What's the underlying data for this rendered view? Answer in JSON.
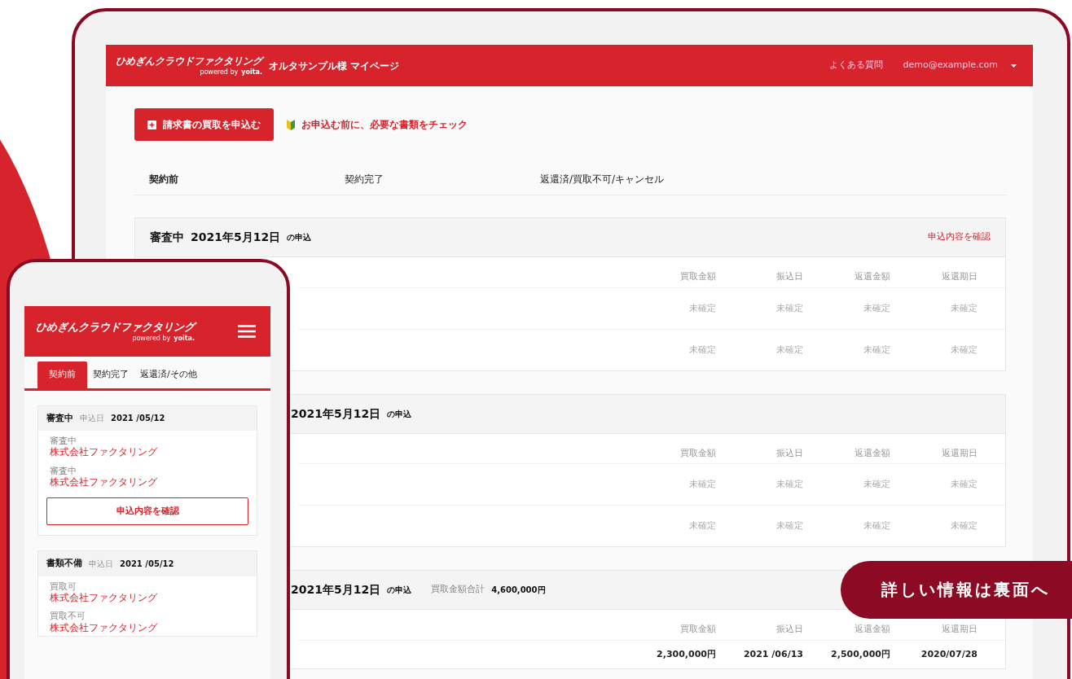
{
  "desktop": {
    "header": {
      "logo": "ひめぎんクラウドファクタリング",
      "powered_by": "powered by",
      "brand": "yoita.",
      "title": "オルタサンプル様 マイページ",
      "faq": "よくある質問",
      "user": "demo@example.com"
    },
    "apply_button": "請求書の買取を申込む",
    "check_link": "お申込む前に、必要な書類をチェック",
    "tabs": [
      {
        "label": "契約前",
        "selected": true
      },
      {
        "label": "契約完了",
        "selected": false
      },
      {
        "label": "返還済/買取不可/キャンセル",
        "selected": false
      }
    ],
    "applications": [
      {
        "status": "審査中",
        "date": "2021年5月12日",
        "suffix": "の申込",
        "link": "申込内容を確認",
        "columns": [
          "買取金額",
          "振込日",
          "返還金額",
          "返還期日"
        ],
        "rows": [
          {
            "confirmed": false,
            "cells": [
              "未確定",
              "未確定",
              "未確定",
              "未確定"
            ]
          },
          {
            "confirmed": false,
            "cells": [
              "未確定",
              "未確定",
              "未確定",
              "未確定"
            ]
          }
        ]
      },
      {
        "date": "2021年5月12日",
        "suffix": "の申込",
        "columns": [
          "買取金額",
          "振込日",
          "返還金額",
          "返還期日"
        ],
        "rows": [
          {
            "confirmed": false,
            "cells": [
              "未確定",
              "未確定",
              "未確定",
              "未確定"
            ]
          },
          {
            "confirmed": false,
            "cells": [
              "未確定",
              "未確定",
              "未確定",
              "未確定"
            ]
          }
        ]
      },
      {
        "date": "2021年5月12日",
        "suffix": "の申込",
        "total_label": "買取金額合計",
        "total": "4,600,000円",
        "columns": [
          "買取金額",
          "振込日",
          "返還金額",
          "返還期日"
        ],
        "rows": [
          {
            "confirmed": true,
            "cells": [
              "2,300,000円",
              "2021 /06/13",
              "2,500,000円",
              "2020/07/28"
            ]
          }
        ]
      }
    ]
  },
  "mobile": {
    "logo": "ひめぎんクラウドファクタリング",
    "powered_by": "powered by",
    "brand": "yoita.",
    "tabs": [
      {
        "label": "契約前",
        "selected": true
      },
      {
        "label": "契約完了",
        "selected": false
      },
      {
        "label": "返還済/その他",
        "selected": false
      }
    ],
    "applications": [
      {
        "status": "審査中",
        "date_label": "申込日",
        "date": "2021 /05/12",
        "items": [
          {
            "status": "審査中",
            "company": "株式会社ファクタリング"
          },
          {
            "status": "審査中",
            "company": "株式会社ファクタリング"
          }
        ],
        "button": "申込内容を確認"
      },
      {
        "status": "書類不備",
        "date_label": "申込日",
        "date": "2021 /05/12",
        "items": [
          {
            "status": "買取可",
            "company": "株式会社ファクタリング"
          },
          {
            "status": "買取不可",
            "company": "株式会社ファクタリング"
          }
        ]
      }
    ]
  },
  "banner": "詳しい情報は裏面へ"
}
